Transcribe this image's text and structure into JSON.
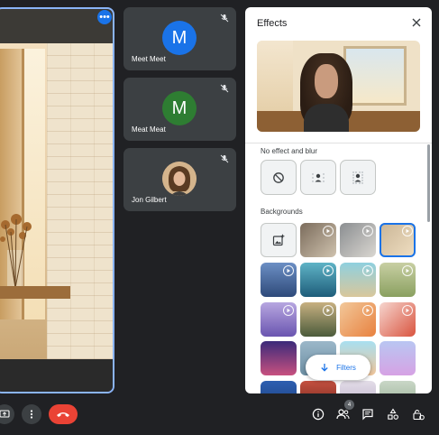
{
  "participants": [
    {
      "name": "Meet Meet",
      "initial": "M",
      "avatar_color": "#1a73e8"
    },
    {
      "name": "Meat Meat",
      "initial": "M",
      "avatar_color": "#2e7d32"
    },
    {
      "name": "Jon Gilbert",
      "initial": "",
      "avatar_color": "#c8a67e"
    }
  ],
  "icons": {
    "more": "more-options-icon",
    "mic_off": "mic-off-icon",
    "present": "present-screen-icon",
    "more_vert": "more-vert-icon",
    "end_call": "end-call-icon",
    "info": "info-icon",
    "people": "people-icon",
    "chat": "chat-icon",
    "activities": "activities-icon",
    "host_controls": "host-controls-icon"
  },
  "people_count": "4",
  "effects_panel": {
    "title": "Effects",
    "section_no_effect": "No effect and blur",
    "section_backgrounds": "Backgrounds",
    "filters_label": "Filters"
  },
  "colors": {
    "background": "#202124",
    "tile": "#3c4043",
    "accent": "#1a73e8",
    "end_call": "#ea4335",
    "selection": "#8ab4f8"
  }
}
